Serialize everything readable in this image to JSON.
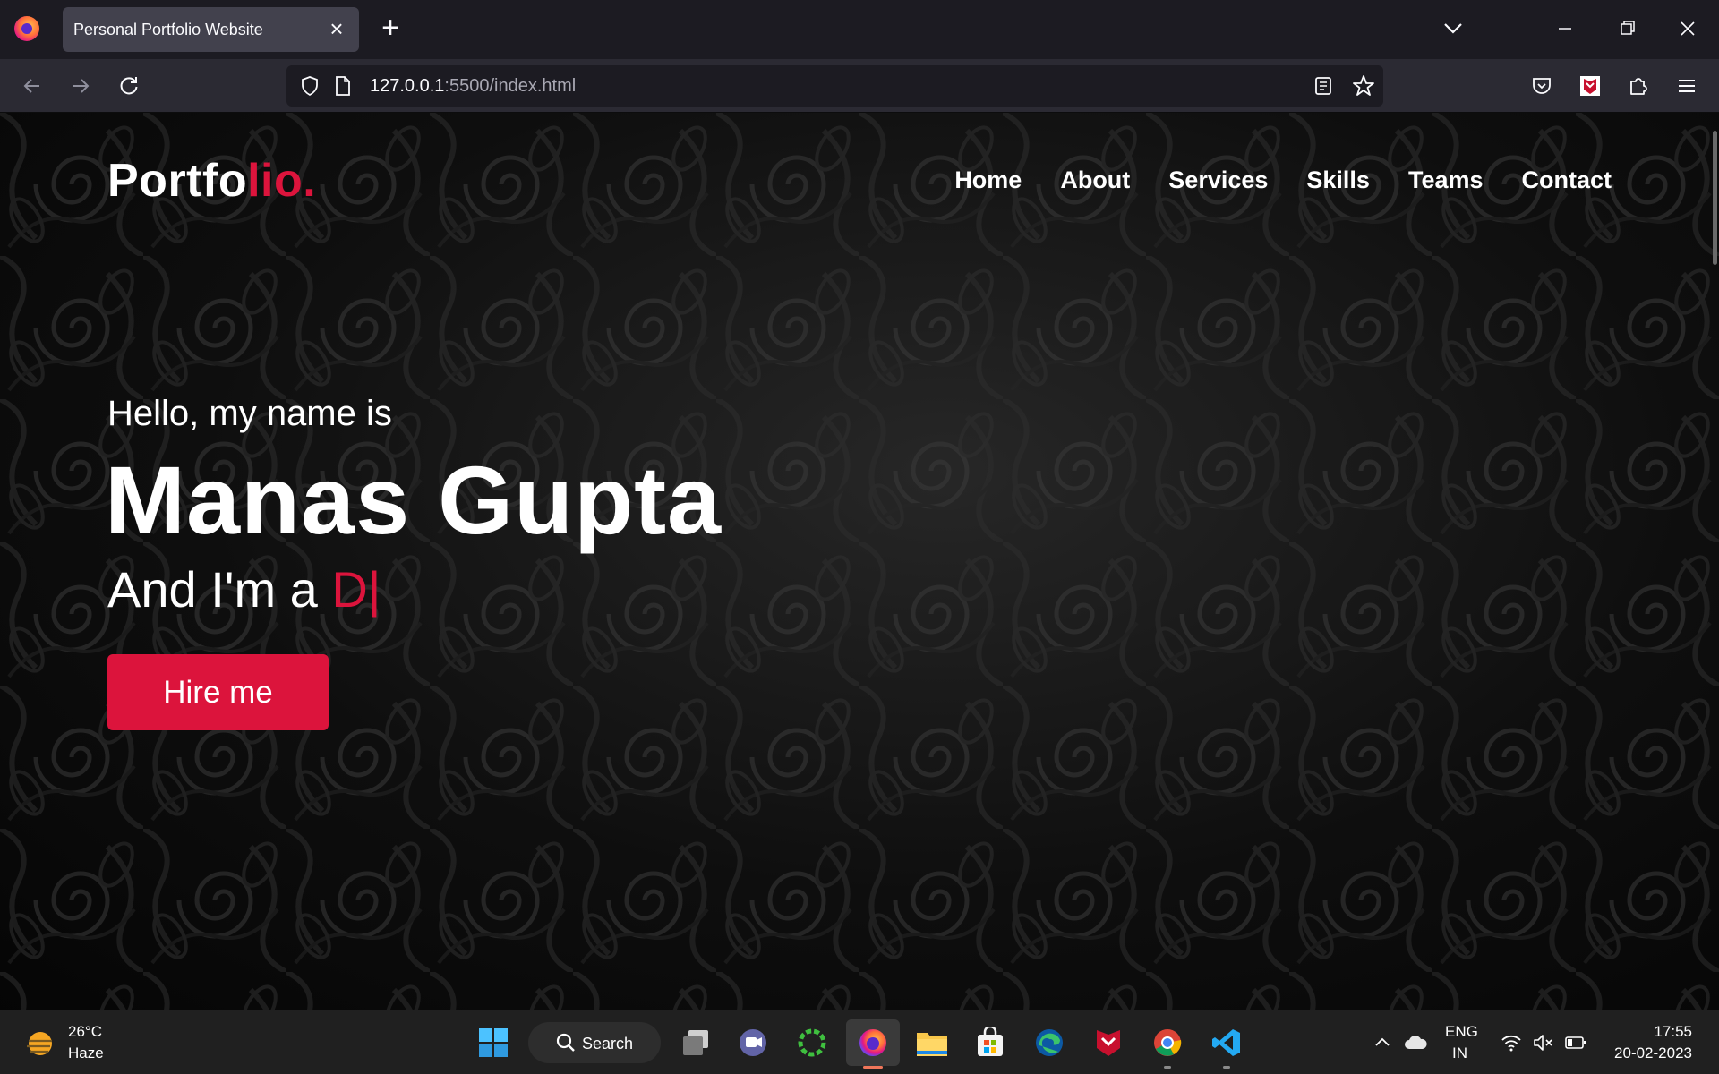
{
  "browser": {
    "tab_title": "Personal Portfolio Website",
    "url_host": "127.0.0.1",
    "url_rest": ":5500/index.html"
  },
  "site": {
    "brand_main": "Portfo",
    "brand_accent": "lio.",
    "nav": [
      {
        "label": "Home"
      },
      {
        "label": "About"
      },
      {
        "label": "Services"
      },
      {
        "label": "Skills"
      },
      {
        "label": "Teams"
      },
      {
        "label": "Contact"
      }
    ],
    "hero": {
      "greeting": "Hello, my name is",
      "name": "Manas Gupta",
      "role_prefix": "And I'm a ",
      "role_typed": "D",
      "cursor": "|",
      "cta": "Hire me"
    }
  },
  "taskbar": {
    "temperature": "26°C",
    "condition": "Haze",
    "search_label": "Search",
    "lang_line1": "ENG",
    "lang_line2": "IN",
    "time": "17:55",
    "date": "20-02-2023"
  },
  "colors": {
    "accent": "#dc143c",
    "toolbar": "#2b2a33",
    "tabstrip": "#1c1b22",
    "taskbar": "#202020"
  },
  "icons": [
    "firefox-icon",
    "close-icon",
    "plus-icon",
    "chevron-down-icon",
    "minimize-icon",
    "restore-icon",
    "back-arrow-icon",
    "forward-arrow-icon",
    "reload-icon",
    "shield-icon",
    "page-icon",
    "reader-view-icon",
    "star-icon",
    "pocket-icon",
    "extension-icon",
    "puzzle-icon",
    "hamburger-menu-icon",
    "weather-icon",
    "windows-start-icon",
    "search-icon",
    "task-view-icon",
    "teams-icon",
    "app-icon",
    "file-explorer-icon",
    "store-icon",
    "edge-icon",
    "shield-app-icon",
    "chrome-icon",
    "vscode-icon",
    "chevron-up-icon",
    "cloud-icon",
    "wifi-icon",
    "speaker-muted-icon",
    "battery-icon"
  ]
}
